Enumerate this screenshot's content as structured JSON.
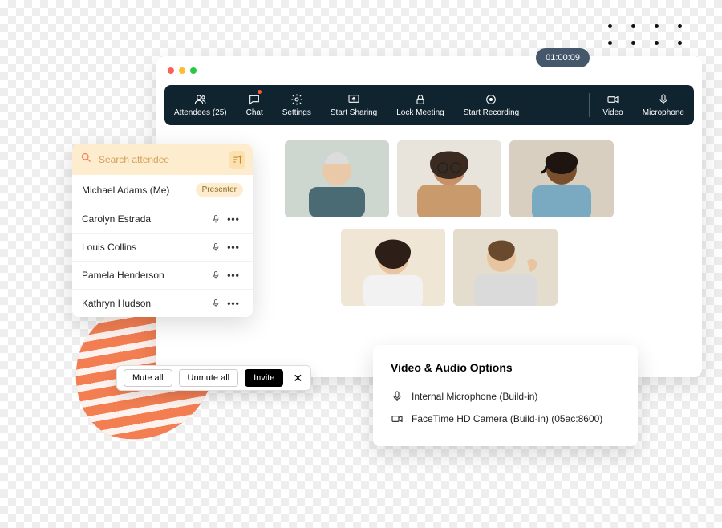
{
  "timer": "01:00:09",
  "toolbar": {
    "attendees": "Attendees (25)",
    "chat": "Chat",
    "settings": "Settings",
    "start_sharing": "Start Sharing",
    "lock_meeting": "Lock Meeting",
    "start_recording": "Start Recording",
    "video": "Video",
    "microphone": "Microphone"
  },
  "attendee_panel": {
    "search_placeholder": "Search attendee",
    "items": [
      {
        "name": "Michael Adams (Me)",
        "role": "Presenter"
      },
      {
        "name": "Carolyn Estrada"
      },
      {
        "name": "Louis Collins"
      },
      {
        "name": "Pamela Henderson"
      },
      {
        "name": "Kathryn Hudson"
      }
    ]
  },
  "bottom_bar": {
    "mute_all": "Mute all",
    "unmute_all": "Unmute all",
    "invite": "Invite"
  },
  "options": {
    "title": "Video & Audio Options",
    "microphone": "Internal Microphone (Build-in)",
    "camera": "FaceTime HD Camera (Build-in) (05ac:8600)"
  },
  "more_glyph": "•••"
}
